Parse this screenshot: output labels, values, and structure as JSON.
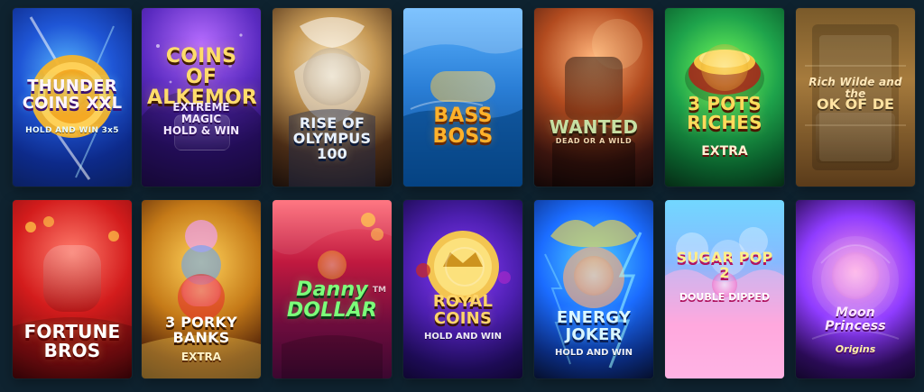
{
  "colors": {
    "page_background": "#0f2330"
  },
  "games": {
    "row1": [
      {
        "title": "THUNDER\nCOINS XXL",
        "subtitle": "HOLD AND WIN 3x5",
        "icon": "coin-icon"
      },
      {
        "title": "COINS OF\nALKEMOR",
        "subtitle": "EXTREME\nMAGIC\nHOLD & WIN",
        "icon": "mage-icon"
      },
      {
        "title": "RISE OF\nOLYMPUS\n100",
        "subtitle": "",
        "icon": "zeus-icon"
      },
      {
        "title": "BASS\nBOSS",
        "subtitle": "",
        "icon": "fish-icon"
      },
      {
        "title": "WANTED",
        "subtitle": "DEAD OR A WILD",
        "icon": "cowboy-icon"
      },
      {
        "title": "3 POTS\nRICHES",
        "subtitle": "EXTRA",
        "icon": "pot-icon"
      },
      {
        "title": "Rich Wilde and the",
        "subtitle": "OK OF DE",
        "icon": "book-icon"
      }
    ],
    "row2": [
      {
        "title": "FORTUNE\nBROS",
        "subtitle": "",
        "icon": "panda-icon"
      },
      {
        "title": "3 PORKY\nBANKS",
        "subtitle": "EXTRA",
        "icon": "pig-icon"
      },
      {
        "title": "Danny\nDOLLAR",
        "subtitle": "TM",
        "icon": "dollar-icon"
      },
      {
        "title": "ROYAL\nCOINS",
        "subtitle": "HOLD AND WIN",
        "icon": "crown-coin-icon"
      },
      {
        "title": "ENERGY\nJOKER",
        "subtitle": "HOLD AND WIN",
        "icon": "joker-icon"
      },
      {
        "title": "SUGAR POP 2",
        "subtitle": "DOUBLE DIPPED",
        "icon": "candy-icon"
      },
      {
        "title": "Moon\nPrincess",
        "subtitle": "Origins",
        "icon": "princess-icon"
      }
    ]
  }
}
